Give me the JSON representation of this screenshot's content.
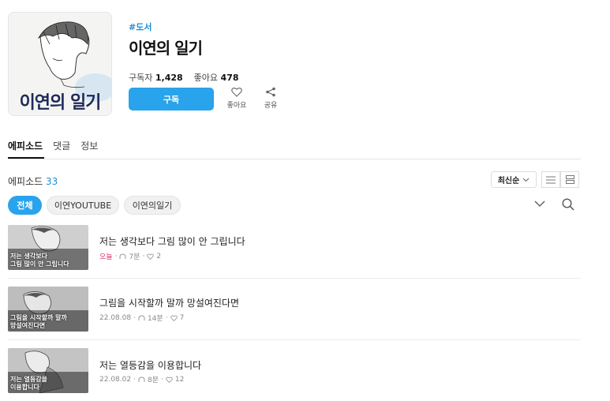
{
  "series": {
    "cover_title": "이연의 일기",
    "genre_tag": "#도서",
    "title": "이연의 일기",
    "subscribers_label": "구독자",
    "subscribers": "1,428",
    "likes_label": "좋아요",
    "likes": "478",
    "subscribe_label": "구독",
    "like_action_label": "좋아요",
    "share_action_label": "공유"
  },
  "tabs": [
    {
      "label": "에피소드",
      "active": true
    },
    {
      "label": "댓글",
      "active": false
    },
    {
      "label": "정보",
      "active": false
    }
  ],
  "episodes_header": {
    "label": "에피소드",
    "count": "33",
    "sort_label": "최신순"
  },
  "filters": [
    {
      "label": "전체",
      "active": true
    },
    {
      "label": "이연YOUTUBE",
      "active": false
    },
    {
      "label": "이연의일기",
      "active": false
    }
  ],
  "episodes": [
    {
      "title": "저는 생각보다 그림 많이 안 그립니다",
      "thumb_caption_1": "저는 생각보다",
      "thumb_caption_2": "그림 많이 안 그립니다",
      "date": "오늘",
      "duration": "7분",
      "likes": "2"
    },
    {
      "title": "그림을 시작할까 말까 망설여진다면",
      "thumb_caption_1": "그림을 시작할까 말까",
      "thumb_caption_2": "망설여진다면",
      "date": "22.08.08",
      "duration": "14분",
      "likes": "7"
    },
    {
      "title": "저는 열등감을 이용합니다",
      "thumb_caption_1": "저는 열등감을",
      "thumb_caption_2": "이용합니다",
      "date": "22.08.02",
      "duration": "8분",
      "likes": "12"
    }
  ],
  "colors": {
    "accent": "#29a3ec",
    "today": "#e0306a"
  }
}
